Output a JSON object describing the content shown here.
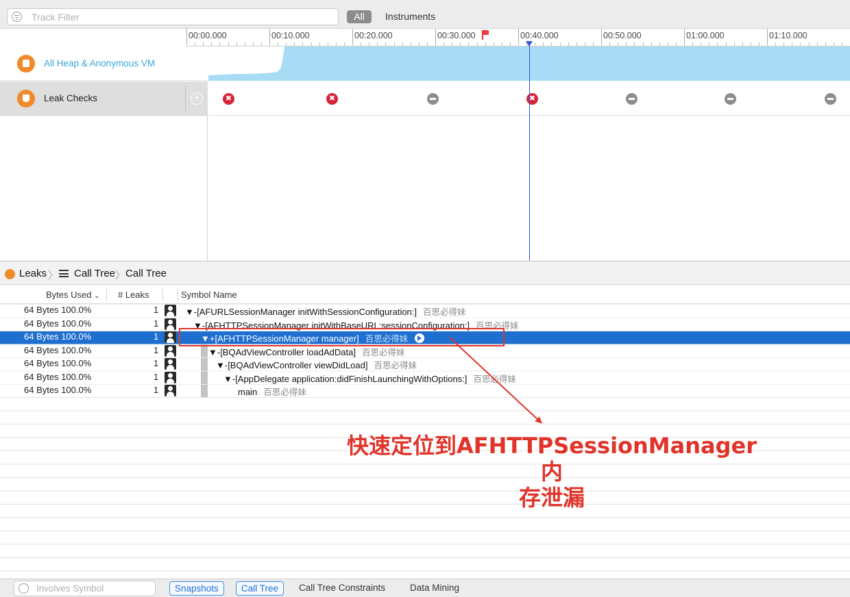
{
  "toolbar": {
    "filter_placeholder": "Track Filter",
    "segment_all": "All",
    "segment_instruments": "Instruments"
  },
  "timeline": {
    "ticks": [
      "00:00.000",
      "00:10.000",
      "00:20.000",
      "00:30.000",
      "00:40.000",
      "00:50.000",
      "01:00.000",
      "01:10.000"
    ],
    "leak_check_marks": [
      "leak",
      "leak",
      "no-leak",
      "leak",
      "no-leak",
      "no-leak",
      "no-leak"
    ]
  },
  "tracks": [
    {
      "label": "All Heap & Anonymous VM",
      "icon": "heap-icon",
      "color": "#3aa6d8"
    },
    {
      "label": "Leak Checks",
      "icon": "leaks-icon"
    }
  ],
  "breadcrumb": {
    "items": [
      "Leaks",
      "Call Tree",
      "Call Tree"
    ]
  },
  "table": {
    "columns": [
      "Bytes Used",
      "# Leaks",
      "Symbol Name"
    ],
    "rows": [
      {
        "bytes": "64 Bytes  100.0%",
        "leaks": "1",
        "symbol": "▼-[AFURLSessionManager initWithSessionConfiguration:]",
        "lib": "百思必得妹"
      },
      {
        "bytes": "64 Bytes  100.0%",
        "leaks": "1",
        "symbol": "▼-[AFHTTPSessionManager initWithBaseURL:sessionConfiguration:]",
        "lib": "百思必得妹"
      },
      {
        "bytes": "64 Bytes  100.0%",
        "leaks": "1",
        "symbol": "▼+[AFHTTPSessionManager manager]",
        "lib": "百思必得妹",
        "selected": true
      },
      {
        "bytes": "64 Bytes  100.0%",
        "leaks": "1",
        "symbol": "▼-[BQAdViewController loadAdData]",
        "lib": "百思必得妹"
      },
      {
        "bytes": "64 Bytes  100.0%",
        "leaks": "1",
        "symbol": "▼-[BQAdViewController viewDidLoad]",
        "lib": "百思必得妹"
      },
      {
        "bytes": "64 Bytes  100.0%",
        "leaks": "1",
        "symbol": "▼-[AppDelegate application:didFinishLaunchingWithOptions:]",
        "lib": "百思必得妹"
      },
      {
        "bytes": "64 Bytes  100.0%",
        "leaks": "1",
        "symbol": "main",
        "lib": "百思必得妹"
      }
    ]
  },
  "annotation": {
    "line1": "快速定位到AFHTTPSessionManager内",
    "line2": "存泄漏",
    "color": "#e0342a"
  },
  "bottom": {
    "filter_placeholder": "Involves Symbol",
    "tabs": [
      "Snapshots",
      "Call Tree",
      "Call Tree Constraints",
      "Data Mining"
    ]
  },
  "colors": {
    "selection": "#1e6fd0",
    "heap_fill": "#a8dcf5",
    "leak_red": "#d8243a",
    "accent_orange": "#f08a2a"
  }
}
